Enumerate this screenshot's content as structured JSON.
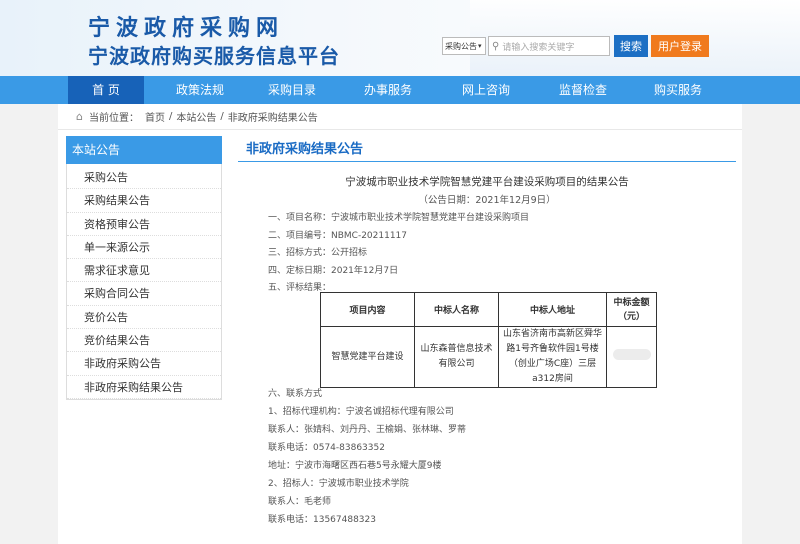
{
  "header": {
    "title_line1": "宁波政府采购网",
    "title_line2": "宁波政府购买服务信息平台",
    "search_type": "采购公告",
    "search_placeholder": "请输入搜索关键字",
    "search_button": "搜索",
    "login_button": "用户登录"
  },
  "nav": [
    "首 页",
    "政策法规",
    "采购目录",
    "办事服务",
    "网上咨询",
    "监督检查",
    "购买服务"
  ],
  "breadcrumb": {
    "label": "当前位置：",
    "items": [
      "首页",
      "/",
      "本站公告",
      "/",
      "非政府采购结果公告"
    ]
  },
  "sidebar": {
    "title": "本站公告",
    "items": [
      "采购公告",
      "采购结果公告",
      "资格预审公告",
      "单一来源公示",
      "需求征求意见",
      "采购合同公告",
      "竞价公告",
      "竞价结果公告",
      "非政府采购公告",
      "非政府采购结果公告"
    ]
  },
  "main": {
    "section_title": "非政府采购结果公告",
    "article_title": "宁波城市职业技术学院智慧党建平台建设采购项目的结果公告",
    "article_date": "（公告日期：2021年12月9日）",
    "lines": [
      "一、项目名称：宁波城市职业技术学院智慧党建平台建设采购项目",
      "二、项目编号：NBMC-20211117",
      "三、招标方式：公开招标",
      "四、定标日期：2021年12月7日",
      "五、评标结果："
    ],
    "table": {
      "headers": [
        "项目内容",
        "中标人名称",
        "中标人地址",
        "中标金额（元）"
      ],
      "row": [
        "智慧党建平台建设",
        "山东森普信息技术有限公司",
        "山东省济南市高新区舜华路1号齐鲁软件园1号楼（创业广场C座）三层a312房间",
        ""
      ]
    },
    "contact_lines": [
      "六、联系方式",
      "1、招标代理机构：宁波名诚招标代理有限公司",
      "联系人：张婧科、刘丹丹、王榆娟、张林琳、罗蒂",
      "联系电话：0574-83863352",
      "地址：宁波市海曙区西石巷5号永耀大厦9楼",
      "2、招标人：宁波城市职业技术学院",
      "联系人：毛老师",
      "联系电话：13567488323"
    ]
  },
  "colors": {
    "brand_blue": "#1a5aa8",
    "nav_blue": "#3a9ae6",
    "nav_active": "#1762b8",
    "search_btn": "#1c6fc4",
    "login_btn": "#f07a1e"
  }
}
